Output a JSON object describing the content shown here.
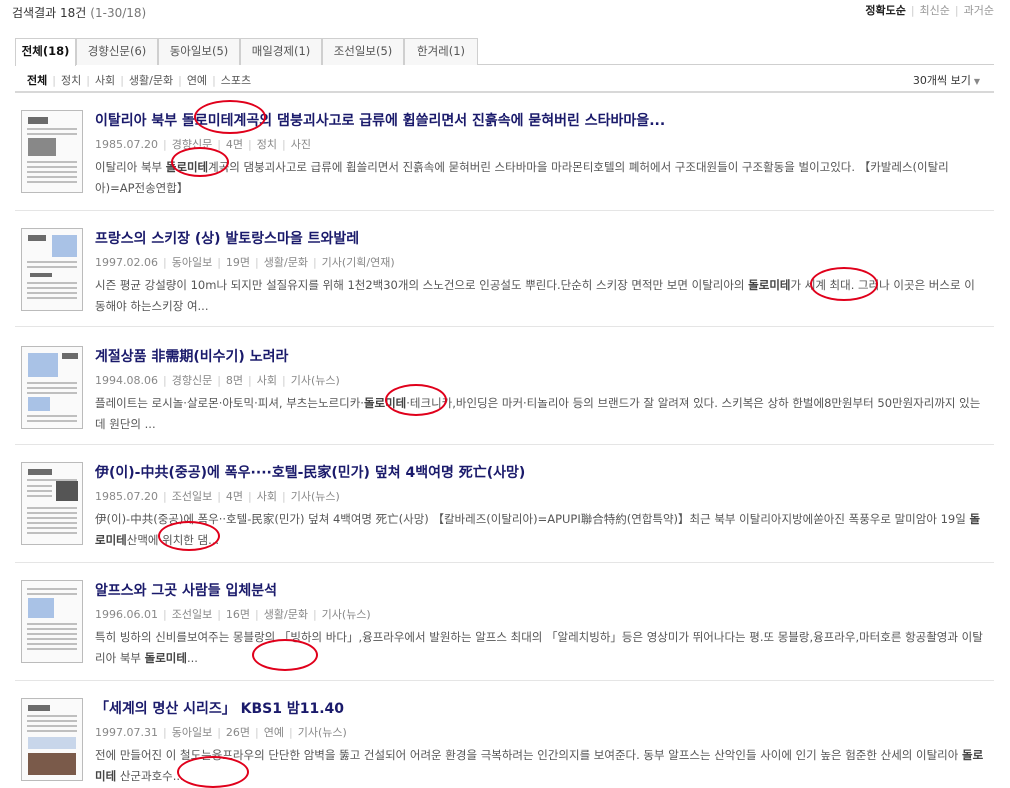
{
  "summary": {
    "count_text": "검색결과 18건",
    "range_text": "(1-30/18)"
  },
  "sort": {
    "items": [
      "정확도순",
      "최신순",
      "과거순"
    ]
  },
  "tabs": [
    "전체(18)",
    "경향신문(6)",
    "동아일보(5)",
    "매일경제(1)",
    "조선일보(5)",
    "한겨레(1)"
  ],
  "subcategories": [
    "전체",
    "정치",
    "사회",
    "생활/문화",
    "연예",
    "스포츠"
  ],
  "per_page": {
    "label": "30개씩 보기"
  },
  "results": [
    {
      "title": "이탈리아 북부 돌로미테계곡의 댐붕괴사고로 급류에 휩쓸리면서 진흙속에 묻혀버린 스타바마을...",
      "date": "1985.07.20",
      "paper": "경향신문",
      "page": "4면",
      "section": "정치",
      "type": "사진",
      "snippet_before": "이탈리아 북부 ",
      "highlight": "돌로미테",
      "snippet_after": "계곡의 댐붕괴사고로 급류에 휩쓸리면서 진흙속에 묻혀버린 스타바마을 마라몬티호텔의 폐허에서 구조대원들이 구조활동을 벌이고있다. 【카발레스(이탈리아)=AP전송연합】"
    },
    {
      "title": "프랑스의 스키장 (상) 발토랑스마을 트와발레",
      "date": "1997.02.06",
      "paper": "동아일보",
      "page": "19면",
      "section": "생활/문화",
      "type": "기사(기획/연재)",
      "snippet_before": "시즌 평균 강설량이 10m나 되지만 설질유지를 위해 1천2백30개의 스노건으로 인공설도 뿌린다.단순히 스키장 면적만 보면 이탈리아의 ",
      "highlight": "돌로미테",
      "snippet_after": "가 세계 최대. 그러나 이곳은 버스로 이동해야 하는스키장 여..."
    },
    {
      "title": "계절상품 非需期(비수기) 노려라",
      "date": "1994.08.06",
      "paper": "경향신문",
      "page": "8면",
      "section": "사회",
      "type": "기사(뉴스)",
      "snippet_before": "플레이트는 로시놀·살로몬·아토믹·피셔, 부츠는노르디카·",
      "highlight": "돌로미테",
      "snippet_after": "·테크니카,바인딩은 마커·티놀리아 등의 브랜드가 잘 알려져 있다. 스키복은 상하 한벌에8만원부터 50만원자리까지 있는데 원단의 ..."
    },
    {
      "title": "伊(이)-中共(중공)에 폭우····호텔-民家(민가) 덮쳐 4백여명 死亡(사망)",
      "date": "1985.07.20",
      "paper": "조선일보",
      "page": "4면",
      "section": "사회",
      "type": "기사(뉴스)",
      "snippet_before": "伊(이)-中共(중공)에 폭우··호텔-民家(민가) 덮쳐 4백여명 死亡(사망) 【칼바레즈(이탈리아)=APUPI聯合特約(연합특약)】최근 북부 이탈리아지방에쏟아진 폭풍우로 말미암아 19일 ",
      "highlight": "돌로미테",
      "snippet_after": "산맥에 위치한 댐..."
    },
    {
      "title": "알프스와 그곳 사람들 입체분석",
      "date": "1996.06.01",
      "paper": "조선일보",
      "page": "16면",
      "section": "생활/문화",
      "type": "기사(뉴스)",
      "snippet_before": "특히 빙하의 신비를보여주는 몽블랑의 「빙하의 바다」,융프라우에서 발원하는 알프스 최대의 「알레치빙하」등은 영상미가 뛰어나다는 평.또 몽블랑,융프라우,마터호른 항공촬영과 이탈리아 북부 ",
      "highlight": "돌로미테",
      "snippet_after": "..."
    },
    {
      "title": "「세계의 명산 시리즈」 KBS1 밤11.40",
      "date": "1997.07.31",
      "paper": "동아일보",
      "page": "26면",
      "section": "연예",
      "type": "기사(뉴스)",
      "snippet_before": "전에 만들어진 이 철도는융프라우의 단단한 암벽을 뚫고 건설되어 어려운 환경을 극복하려는 인간의지를 보여준다. 동부 알프스는 산악인들 사이에 인기 높은 험준한 산세의 이탈리아 ",
      "highlight": "돌로미테",
      "snippet_after": " 산군과호수..."
    }
  ]
}
